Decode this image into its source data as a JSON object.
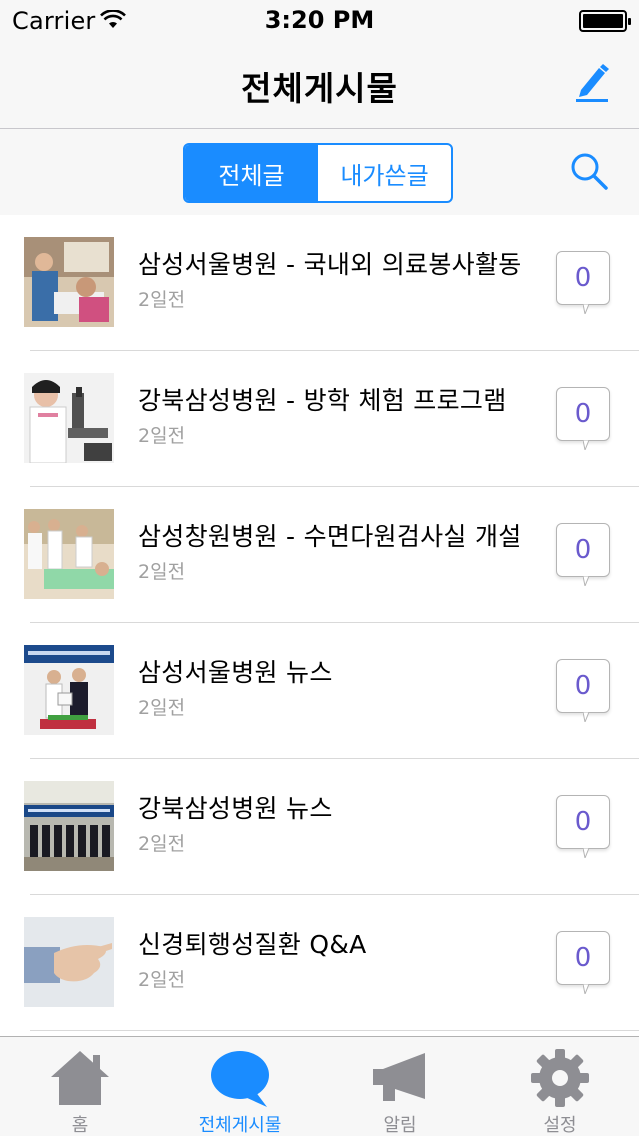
{
  "status_bar": {
    "carrier": "Carrier",
    "time": "3:20 PM"
  },
  "nav": {
    "title": "전체게시물",
    "compose_icon": "compose-icon"
  },
  "segments": [
    {
      "label": "전체글",
      "selected": true
    },
    {
      "label": "내가쓴글",
      "selected": false
    }
  ],
  "search_icon": "search-icon",
  "posts": [
    {
      "title": "삼성서울병원 - 국내외 의료봉사활동",
      "time": "2일전",
      "comments": "0"
    },
    {
      "title": "강북삼성병원 - 방학 체험 프로그램",
      "time": "2일전",
      "comments": "0"
    },
    {
      "title": "삼성창원병원 - 수면다원검사실 개설",
      "time": "2일전",
      "comments": "0"
    },
    {
      "title": "삼성서울병원 뉴스",
      "time": "2일전",
      "comments": "0"
    },
    {
      "title": "강북삼성병원 뉴스",
      "time": "2일전",
      "comments": "0"
    },
    {
      "title": "신경퇴행성질환 Q&A",
      "time": "2일전",
      "comments": "0"
    }
  ],
  "tabs": [
    {
      "label": "홈",
      "icon": "home-icon",
      "active": false
    },
    {
      "label": "전체게시물",
      "icon": "chat-bubble-icon",
      "active": true
    },
    {
      "label": "알림",
      "icon": "megaphone-icon",
      "active": false
    },
    {
      "label": "설정",
      "icon": "gear-icon",
      "active": false
    }
  ],
  "colors": {
    "accent": "#1a8cff",
    "comment_count": "#6a5acd",
    "meta_text": "#a0a0a0"
  }
}
